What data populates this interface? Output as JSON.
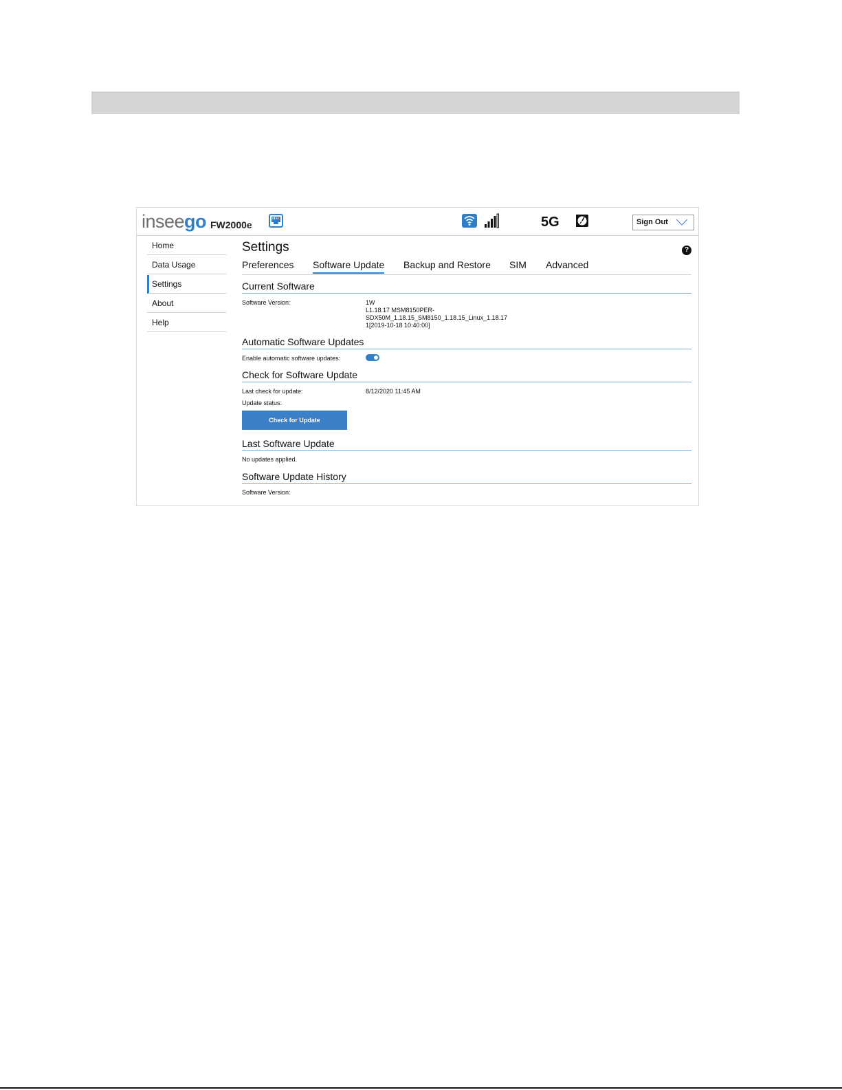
{
  "header": {
    "logo_part1": "insee",
    "logo_part2": "go",
    "model": "FW2000e",
    "network_label": "5G",
    "sign_out_label": "Sign Out",
    "icons": [
      "ethernet-icon",
      "wifi-icon",
      "signal-icon",
      "speed-icon",
      "chevron-down-icon"
    ],
    "accent_color": "#2f7fc8"
  },
  "sidebar": {
    "items": [
      {
        "label": "Home"
      },
      {
        "label": "Data Usage"
      },
      {
        "label": "Settings",
        "active": true
      },
      {
        "label": "About"
      },
      {
        "label": "Help"
      }
    ]
  },
  "main": {
    "title": "Settings",
    "help_glyph": "?",
    "tabs": [
      {
        "label": "Preferences"
      },
      {
        "label": "Software Update",
        "active": true
      },
      {
        "label": "Backup and Restore"
      },
      {
        "label": "SIM"
      },
      {
        "label": "Advanced"
      }
    ],
    "current_software": {
      "heading": "Current Software",
      "version_label": "Software Version:",
      "version_lines": [
        "1W",
        "L1.18.17 MSM8150PER-",
        "SDX50M_1.18.15_SM8150_1.18.15_Linux_1.18.17",
        "1[2019-10-18 10:40:00]"
      ]
    },
    "auto_updates": {
      "heading": "Automatic Software Updates",
      "enable_label": "Enable automatic software updates:",
      "enabled": true
    },
    "check_update": {
      "heading": "Check for Software Update",
      "last_check_label": "Last check for update:",
      "last_check_value": "8/12/2020 11:45 AM",
      "status_label": "Update status:",
      "button_label": "Check for Update"
    },
    "last_update": {
      "heading": "Last Software Update",
      "text": "No updates applied."
    },
    "history": {
      "heading": "Software Update History",
      "version_label": "Software Version:"
    }
  }
}
